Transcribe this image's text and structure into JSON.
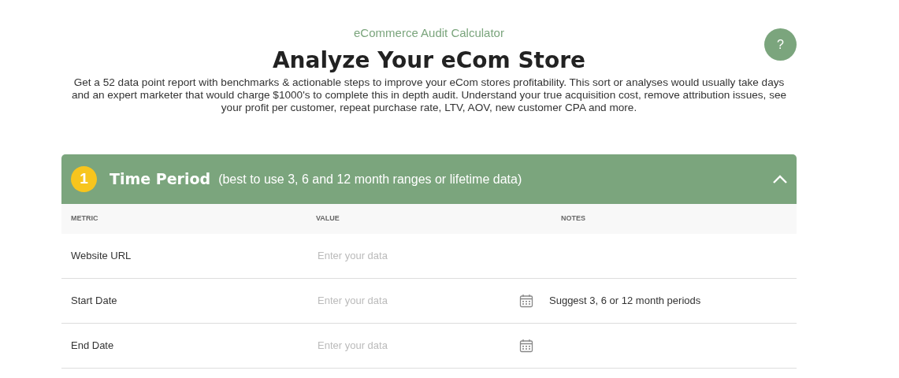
{
  "help_button": "?",
  "kicker": "eCommerce Audit Calculator",
  "title": "Analyze Your eCom Store",
  "description": "Get a 52 data point report with benchmarks & actionable steps to improve your eCom stores profitability. This sort or analyses would usually take days and an expert marketer that would charge $1000's to complete this in depth audit. Understand your true acquisition cost, remove attribution issues, see your profit per customer, repeat purchase rate, LTV, AOV, new customer CPA and more.",
  "section": {
    "number": "1",
    "title": "Time Period",
    "hint": "(best to use 3, 6 and 12 month ranges or lifetime data)",
    "expanded": true,
    "columns": [
      "METRIC",
      "VALUE",
      "NOTES"
    ],
    "rows": [
      {
        "kind": "text",
        "metric": "Website URL",
        "placeholder": "Enter your data"
      },
      {
        "kind": "date",
        "metric": "Start Date",
        "placeholder": "Enter your data",
        "note": "Suggest 3, 6 or 12 month periods"
      },
      {
        "kind": "date",
        "metric": "End Date",
        "placeholder": "Enter your data"
      }
    ]
  }
}
